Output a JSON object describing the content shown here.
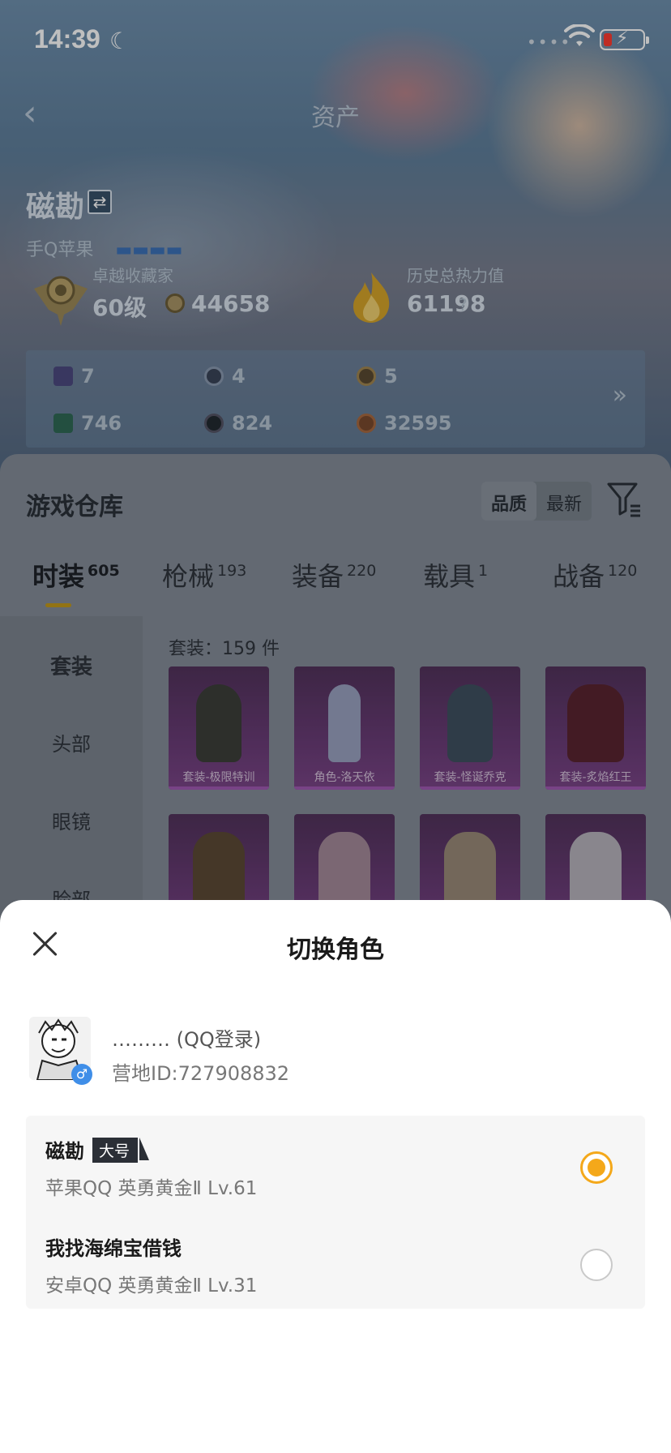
{
  "status_bar": {
    "time": "14:39"
  },
  "nav": {
    "title": "资产"
  },
  "profile": {
    "name": "磁勘",
    "platform": "手Q苹果"
  },
  "stats": {
    "rank_label": "卓越收藏家",
    "level": "60级",
    "coins": "44658",
    "heat_label": "历史总热力值",
    "heat_value": "61198",
    "heat_help": "?"
  },
  "assets": {
    "items": [
      "7",
      "4",
      "5",
      "746",
      "824",
      "32595"
    ],
    "more": "»"
  },
  "warehouse": {
    "title": "游戏仓库",
    "sort_quality": "品质",
    "sort_newest": "最新",
    "tabs": [
      {
        "label": "时装",
        "count": "605"
      },
      {
        "label": "枪械",
        "count": "193"
      },
      {
        "label": "装备",
        "count": "220"
      },
      {
        "label": "载具",
        "count": "1"
      },
      {
        "label": "战备",
        "count": "120"
      }
    ],
    "categories": [
      "套装",
      "头部",
      "眼镜",
      "脸部"
    ],
    "item_count": "套装：159 件",
    "items": [
      "套装-极限特训",
      "角色-洛天依",
      "套装-怪诞乔克",
      "套装-炙焰红王",
      "",
      "",
      "",
      ""
    ]
  },
  "sheet": {
    "title": "切换角色",
    "account_name": "……… (QQ登录)",
    "account_id": "营地ID:727908832",
    "gender_icon": "♂",
    "roles": [
      {
        "name": "磁勘",
        "tag": "大号",
        "info": "苹果QQ   英勇黄金Ⅱ   Lv.61",
        "selected": true
      },
      {
        "name": "我找海绵宝借钱",
        "tag": "",
        "info": "安卓QQ   英勇黄金Ⅱ   Lv.31",
        "selected": false
      }
    ]
  },
  "colors": {
    "accent": "#f4a81a",
    "tab_indicator": "#c39a1b",
    "item_bg": "#6a3c77"
  }
}
